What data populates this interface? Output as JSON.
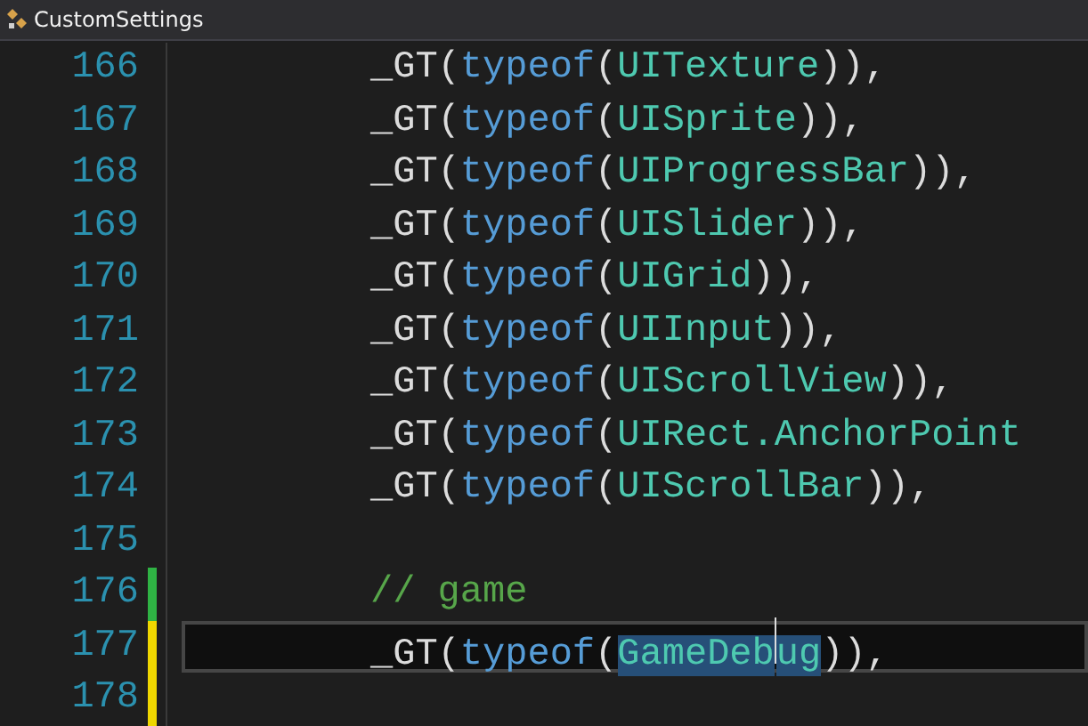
{
  "tab": {
    "title": "CustomSettings"
  },
  "lines": [
    {
      "number": "166",
      "current": false,
      "tokens": [
        {
          "text": "_GT(",
          "kind": "plain"
        },
        {
          "text": "typeof",
          "kind": "keyword"
        },
        {
          "text": "(",
          "kind": "plain"
        },
        {
          "text": "UITexture",
          "kind": "type"
        },
        {
          "text": ")),",
          "kind": "plain"
        }
      ]
    },
    {
      "number": "167",
      "current": false,
      "tokens": [
        {
          "text": "_GT(",
          "kind": "plain"
        },
        {
          "text": "typeof",
          "kind": "keyword"
        },
        {
          "text": "(",
          "kind": "plain"
        },
        {
          "text": "UISprite",
          "kind": "type"
        },
        {
          "text": ")),",
          "kind": "plain"
        }
      ]
    },
    {
      "number": "168",
      "current": false,
      "tokens": [
        {
          "text": "_GT(",
          "kind": "plain"
        },
        {
          "text": "typeof",
          "kind": "keyword"
        },
        {
          "text": "(",
          "kind": "plain"
        },
        {
          "text": "UIProgressBar",
          "kind": "type"
        },
        {
          "text": ")),",
          "kind": "plain"
        }
      ]
    },
    {
      "number": "169",
      "current": false,
      "tokens": [
        {
          "text": "_GT(",
          "kind": "plain"
        },
        {
          "text": "typeof",
          "kind": "keyword"
        },
        {
          "text": "(",
          "kind": "plain"
        },
        {
          "text": "UISlider",
          "kind": "type"
        },
        {
          "text": ")),",
          "kind": "plain"
        }
      ]
    },
    {
      "number": "170",
      "current": false,
      "tokens": [
        {
          "text": "_GT(",
          "kind": "plain"
        },
        {
          "text": "typeof",
          "kind": "keyword"
        },
        {
          "text": "(",
          "kind": "plain"
        },
        {
          "text": "UIGrid",
          "kind": "type"
        },
        {
          "text": ")),",
          "kind": "plain"
        }
      ]
    },
    {
      "number": "171",
      "current": false,
      "tokens": [
        {
          "text": "_GT(",
          "kind": "plain"
        },
        {
          "text": "typeof",
          "kind": "keyword"
        },
        {
          "text": "(",
          "kind": "plain"
        },
        {
          "text": "UIInput",
          "kind": "type"
        },
        {
          "text": ")),",
          "kind": "plain"
        }
      ]
    },
    {
      "number": "172",
      "current": false,
      "tokens": [
        {
          "text": "_GT(",
          "kind": "plain"
        },
        {
          "text": "typeof",
          "kind": "keyword"
        },
        {
          "text": "(",
          "kind": "plain"
        },
        {
          "text": "UIScrollView",
          "kind": "type"
        },
        {
          "text": ")),",
          "kind": "plain"
        }
      ]
    },
    {
      "number": "173",
      "current": false,
      "tokens": [
        {
          "text": "_GT(",
          "kind": "plain"
        },
        {
          "text": "typeof",
          "kind": "keyword"
        },
        {
          "text": "(",
          "kind": "plain"
        },
        {
          "text": "UIRect.AnchorPoint",
          "kind": "type"
        }
      ]
    },
    {
      "number": "174",
      "current": false,
      "tokens": [
        {
          "text": "_GT(",
          "kind": "plain"
        },
        {
          "text": "typeof",
          "kind": "keyword"
        },
        {
          "text": "(",
          "kind": "plain"
        },
        {
          "text": "UIScrollBar",
          "kind": "type"
        },
        {
          "text": ")),",
          "kind": "plain"
        }
      ]
    },
    {
      "number": "175",
      "current": false
    },
    {
      "number": "176",
      "changed": true,
      "saved": true,
      "current": false,
      "tokens": [
        {
          "text": "// game",
          "kind": "comment"
        }
      ]
    },
    {
      "number": "177",
      "changed": true,
      "saved": false,
      "current": true,
      "tokens": [
        {
          "text": "_GT(",
          "kind": "plain"
        },
        {
          "text": "typeof",
          "kind": "keyword"
        },
        {
          "text": "(",
          "kind": "plain"
        },
        {
          "text": "GameDeb",
          "kind": "type",
          "selected": true,
          "caret": true
        },
        {
          "text": "ug",
          "kind": "type",
          "selected": true
        },
        {
          "text": ")),",
          "kind": "plain"
        }
      ]
    },
    {
      "number": "178",
      "changed": true,
      "saved": false,
      "current": false
    }
  ]
}
